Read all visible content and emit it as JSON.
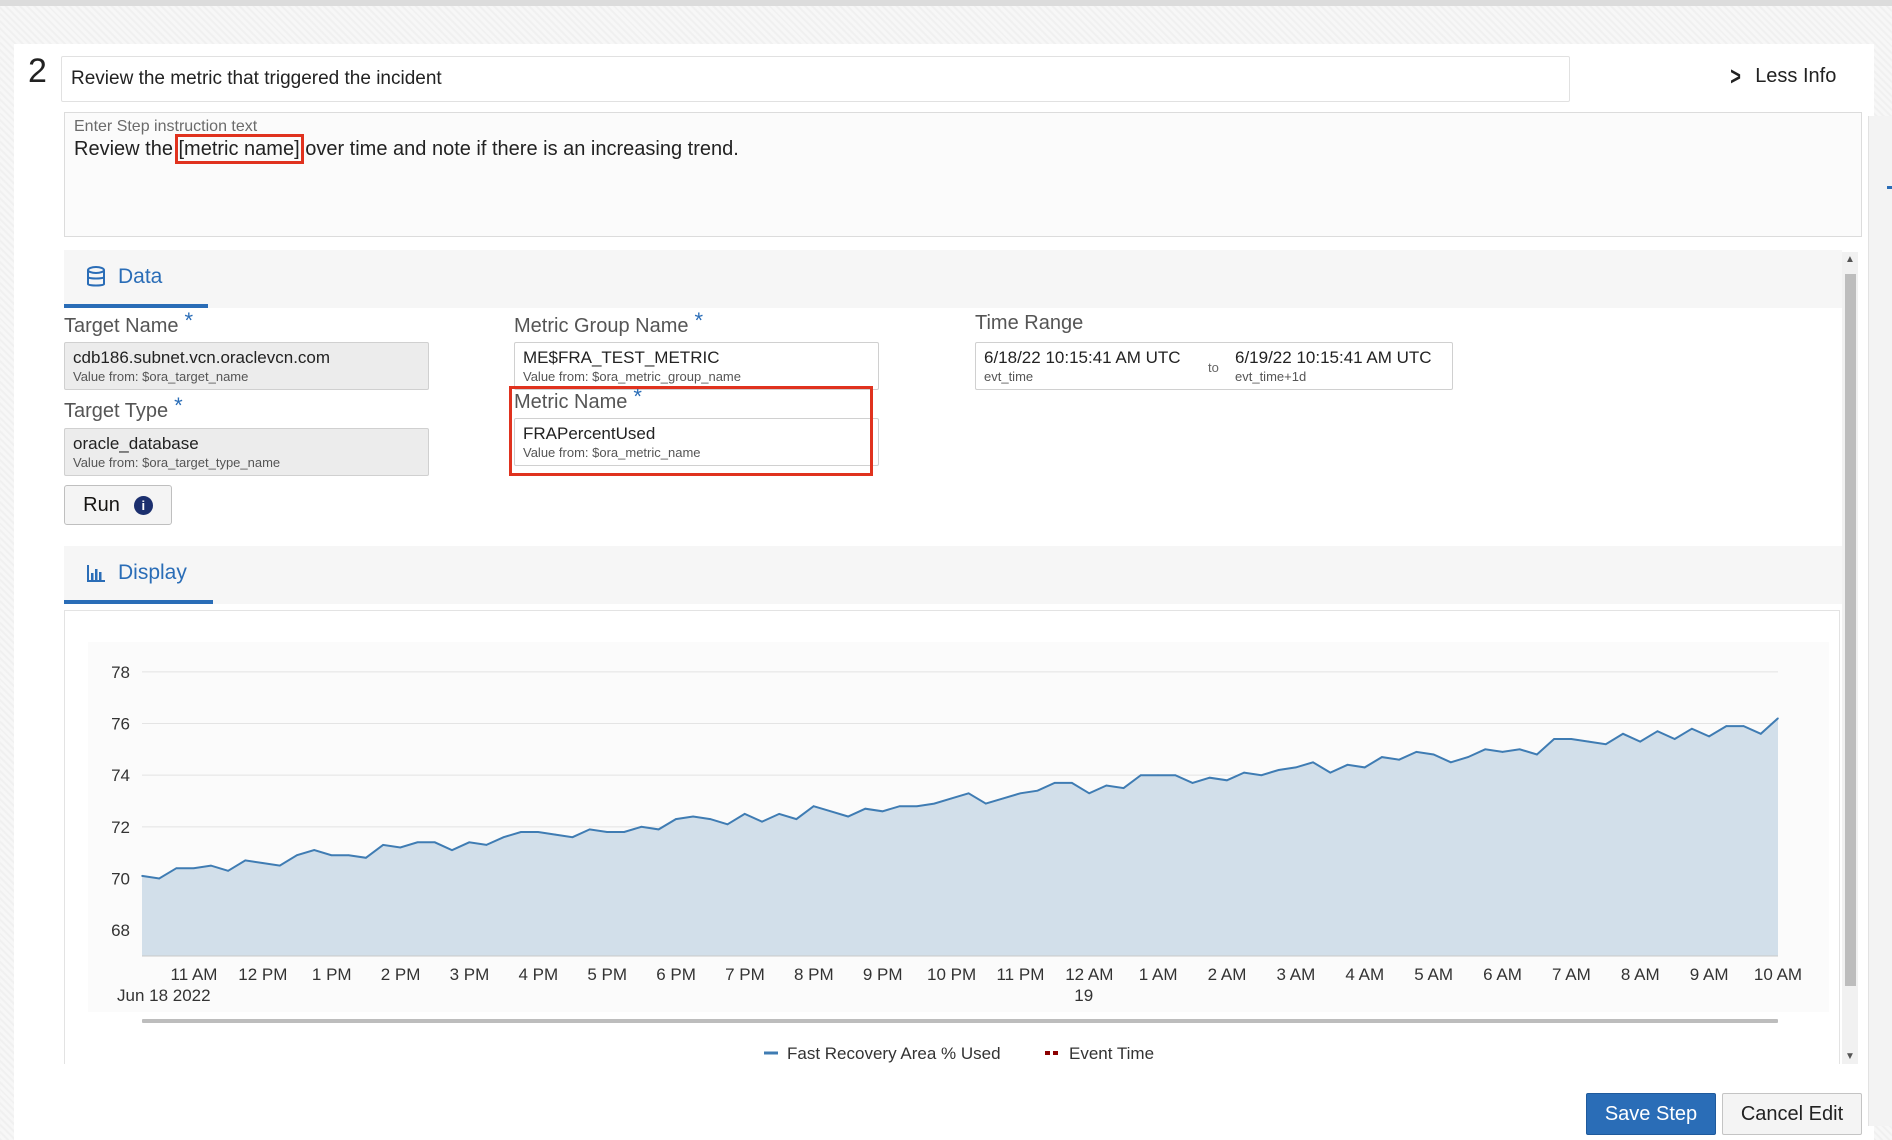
{
  "step": {
    "number": "2",
    "title": "Review the metric that triggered the incident",
    "less_info": "Less Info"
  },
  "instruction": {
    "label": "Enter Step instruction text",
    "text_before": "Review the ",
    "text_highlight": "[metric name]",
    "text_after": " over time and note if there is an increasing trend."
  },
  "data_tab": {
    "label": "Data",
    "icon": "database-icon"
  },
  "fields": {
    "target_name": {
      "label": "Target Name",
      "value": "cdb186.subnet.vcn.oraclevcn.com",
      "source": "Value from: $ora_target_name"
    },
    "target_type": {
      "label": "Target Type",
      "value": "oracle_database",
      "source": "Value from: $ora_target_type_name"
    },
    "metric_group_name": {
      "label": "Metric Group Name",
      "value": "ME$FRA_TEST_METRIC",
      "source": "Value from: $ora_metric_group_name"
    },
    "metric_name": {
      "label": "Metric Name",
      "value": "FRAPercentUsed",
      "source": "Value from: $ora_metric_name"
    },
    "time_range": {
      "label": "Time Range",
      "from_value": "6/18/22 10:15:41 AM UTC",
      "from_source": "evt_time",
      "to_label": "to",
      "to_value": "6/19/22 10:15:41 AM UTC",
      "to_source": "evt_time+1d"
    },
    "required_mark": "*"
  },
  "run_button": {
    "label": "Run",
    "info_icon": "info-icon"
  },
  "display_tab": {
    "label": "Display",
    "icon": "bar-chart-icon"
  },
  "chart_data": {
    "type": "area",
    "title": "",
    "xlabel": "",
    "ylabel": "",
    "ylim": [
      67,
      79
    ],
    "yticks": [
      68,
      70,
      72,
      74,
      76,
      78
    ],
    "xticks": [
      "11 AM",
      "12 PM",
      "1 PM",
      "2 PM",
      "3 PM",
      "4 PM",
      "5 PM",
      "6 PM",
      "7 PM",
      "8 PM",
      "9 PM",
      "10 PM",
      "11 PM",
      "12 AM",
      "1 AM",
      "2 AM",
      "3 AM",
      "4 AM",
      "5 AM",
      "6 AM",
      "7 AM",
      "8 AM",
      "9 AM",
      "10 AM"
    ],
    "xtick_sublabels": {
      "first": "Jun 18 2022",
      "12 AM": "19"
    },
    "grid": true,
    "legend_position": "bottom",
    "series": [
      {
        "name": "Fast Recovery Area % Used",
        "color": "#3f7cb3",
        "fill": "#d2dfea",
        "values": [
          70.1,
          70.0,
          70.4,
          70.4,
          70.5,
          70.3,
          70.7,
          70.6,
          70.5,
          70.9,
          71.1,
          70.9,
          70.9,
          70.8,
          71.3,
          71.2,
          71.4,
          71.4,
          71.1,
          71.4,
          71.3,
          71.6,
          71.8,
          71.8,
          71.7,
          71.6,
          71.9,
          71.8,
          71.8,
          72.0,
          71.9,
          72.3,
          72.4,
          72.3,
          72.1,
          72.5,
          72.2,
          72.5,
          72.3,
          72.8,
          72.6,
          72.4,
          72.7,
          72.6,
          72.8,
          72.8,
          72.9,
          73.1,
          73.3,
          72.9,
          73.1,
          73.3,
          73.4,
          73.7,
          73.7,
          73.3,
          73.6,
          73.5,
          74.0,
          74.0,
          74.0,
          73.7,
          73.9,
          73.8,
          74.1,
          74.0,
          74.2,
          74.3,
          74.5,
          74.1,
          74.4,
          74.3,
          74.7,
          74.6,
          74.9,
          74.8,
          74.5,
          74.7,
          75.0,
          74.9,
          75.0,
          74.8,
          75.4,
          75.4,
          75.3,
          75.2,
          75.6,
          75.3,
          75.7,
          75.4,
          75.8,
          75.5,
          75.9,
          75.9,
          75.6,
          76.2
        ]
      },
      {
        "name": "Event Time",
        "color": "#8b0000",
        "style": "dashed"
      }
    ]
  },
  "footer": {
    "save": "Save Step",
    "cancel": "Cancel Edit"
  }
}
